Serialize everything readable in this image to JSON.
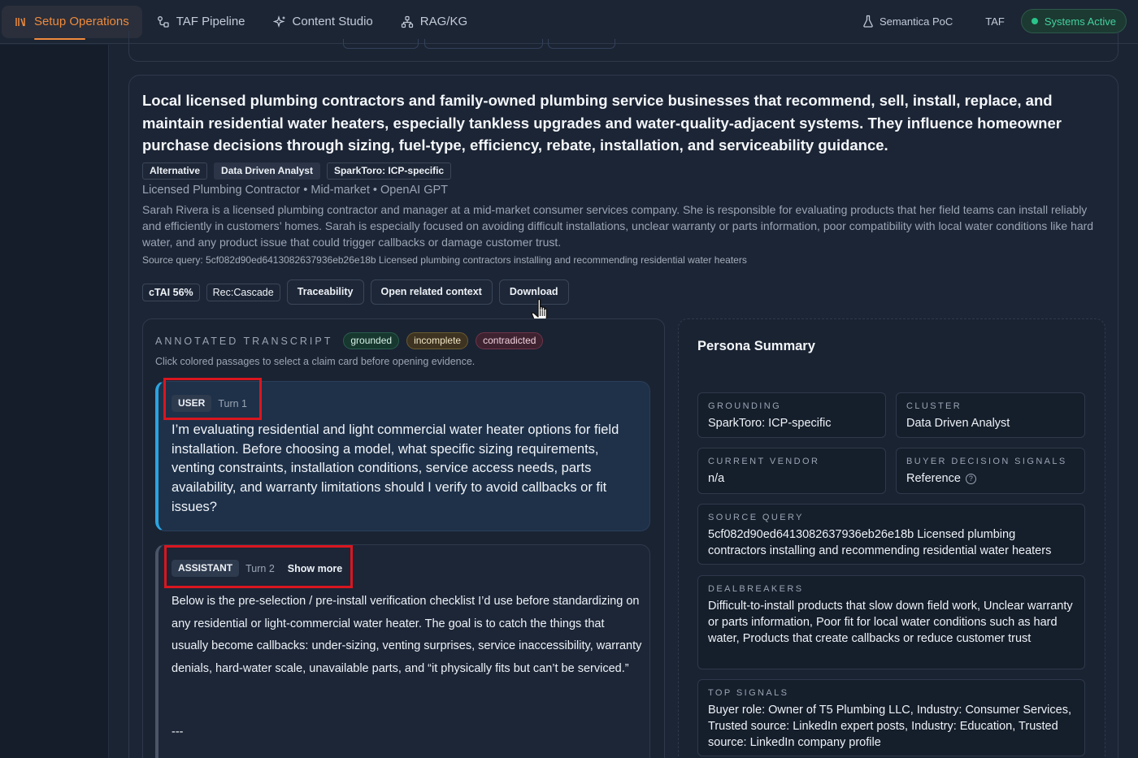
{
  "nav": {
    "tabs": [
      {
        "label": "Setup Operations",
        "icon": "library-icon"
      },
      {
        "label": "TAF Pipeline",
        "icon": "pipeline-icon"
      },
      {
        "label": "Content Studio",
        "icon": "sparkle-icon"
      },
      {
        "label": "RAG/KG",
        "icon": "graph-icon"
      }
    ],
    "right": {
      "poc_label": "Semantica PoC",
      "taf_label": "TAF",
      "status_label": "Systems Active"
    }
  },
  "persona": {
    "headline": "Local licensed plumbing contractors and family-owned plumbing service businesses that recommend, sell, install, replace, and maintain residential water heaters, especially tankless upgrades and water-quality-adjacent systems. They influence homeowner purchase decisions through sizing, fuel-type, efficiency, rebate, installation, and serviceability guidance.",
    "tags": [
      "Alternative",
      "Data Driven Analyst",
      "SparkToro: ICP-specific"
    ],
    "subline": "Licensed Plumbing Contractor • Mid-market • OpenAI GPT",
    "description": "Sarah Rivera is a licensed plumbing contractor and manager at a mid-market consumer services company. She is responsible for evaluating products that her field teams can install reliably and efficiently in customers’ homes. Sarah is especially focused on avoiding difficult installations, unclear warranty or parts information, poor compatibility with local water conditions like hard water, and any product issue that could trigger callbacks or damage customer trust.",
    "source_query": "Source query: 5cf082d90ed6413082637936eb26e18b Licensed plumbing contractors installing and recommending residential water heaters"
  },
  "actions": {
    "ctai": "cTAI 56%",
    "rec": "Rec:Cascade",
    "traceability": "Traceability",
    "open_context": "Open related context",
    "download": "Download"
  },
  "transcript": {
    "title": "ANNOTATED TRANSCRIPT",
    "legend": {
      "grounded": "grounded",
      "incomplete": "incomplete",
      "contradicted": "contradicted"
    },
    "hint": "Click colored passages to select a claim card before opening evidence.",
    "user": {
      "role": "USER",
      "turn": "Turn 1",
      "text": "I’m evaluating residential and light commercial water heater options for field installation. Before choosing a model, what specific sizing requirements, venting constraints, installation conditions, service access needs, parts availability, and warranty limitations should I verify to avoid callbacks or fit issues?"
    },
    "assistant": {
      "role": "ASSISTANT",
      "turn": "Turn 2",
      "show_more": "Show more",
      "text": "Below is the pre-selection / pre-install verification checklist I’d use before standardizing on any residential or light-commercial water heater. The goal is to catch the things that usually become callbacks: under-sizing, venting surprises, service inaccessibility, warranty denials, hard-water scale, unavailable parts, and “it physically fits but can’t be serviced.”",
      "separator": "---"
    }
  },
  "summary": {
    "title": "Persona Summary",
    "grounding": {
      "label": "GROUNDING",
      "value": "SparkToro: ICP-specific"
    },
    "cluster": {
      "label": "CLUSTER",
      "value": "Data Driven Analyst"
    },
    "vendor": {
      "label": "CURRENT VENDOR",
      "value": "n/a"
    },
    "signals": {
      "label": "BUYER DECISION SIGNALS",
      "value": "Reference"
    },
    "source_query": {
      "label": "SOURCE QUERY",
      "value": "5cf082d90ed6413082637936eb26e18b Licensed plumbing contractors installing and recommending residential water heaters"
    },
    "dealbreakers": {
      "label": "DEALBREAKERS",
      "value": "Difficult-to-install products that slow down field work, Unclear warranty or parts information, Poor fit for local water conditions such as hard water, Products that create callbacks or reduce customer trust"
    },
    "top_signals": {
      "label": "TOP SIGNALS",
      "value": "Buyer role: Owner of T5 Plumbing LLC, Industry: Consumer Services, Trusted source: LinkedIn expert posts, Industry: Education, Trusted source: LinkedIn company profile"
    }
  },
  "colors": {
    "accent": "#f08a3c",
    "active_status": "#43d19e",
    "user_border": "#2ba4e0",
    "highlight_box": "#d9161f"
  }
}
